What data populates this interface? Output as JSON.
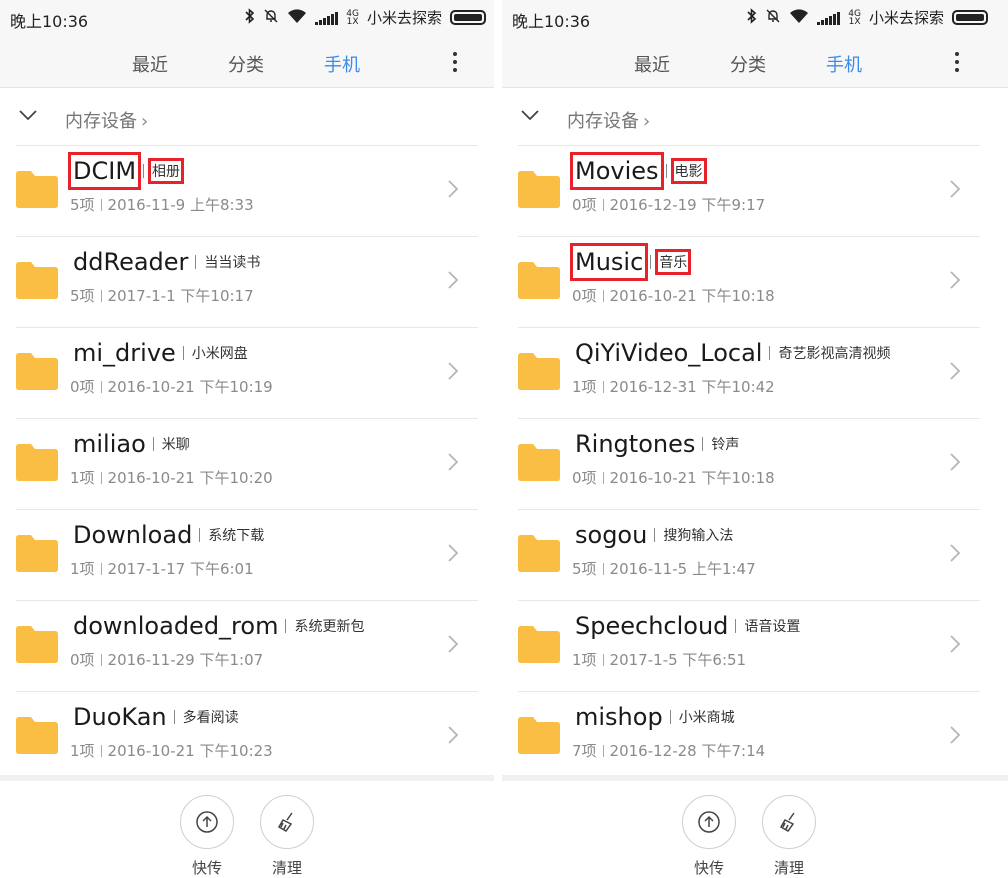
{
  "status": {
    "time": "晚上10:36",
    "network_top": "4G",
    "network_bottom": "1X",
    "carrier": "小米去探索"
  },
  "tabs": [
    {
      "label": "最近",
      "active": false
    },
    {
      "label": "分类",
      "active": false
    },
    {
      "label": "手机",
      "active": true
    }
  ],
  "breadcrumb": {
    "label": "内存设备",
    "arrow": "›"
  },
  "left_list": [
    {
      "name": "DCIM",
      "alias": "相册",
      "count": "5项",
      "date": "2016-11-9 上午8:33",
      "highlight": true
    },
    {
      "name": "ddReader",
      "alias": "当当读书",
      "count": "5项",
      "date": "2017-1-1 下午10:17",
      "highlight": false
    },
    {
      "name": "mi_drive",
      "alias": "小米网盘",
      "count": "0项",
      "date": "2016-10-21 下午10:19",
      "highlight": false
    },
    {
      "name": "miliao",
      "alias": "米聊",
      "count": "1项",
      "date": "2016-10-21 下午10:20",
      "highlight": false
    },
    {
      "name": "Download",
      "alias": "系统下载",
      "count": "1项",
      "date": "2017-1-17 下午6:01",
      "highlight": false
    },
    {
      "name": "downloaded_rom",
      "alias": "系统更新包",
      "count": "0项",
      "date": "2016-11-29 下午1:07",
      "highlight": false
    },
    {
      "name": "DuoKan",
      "alias": "多看阅读",
      "count": "1项",
      "date": "2016-10-21 下午10:23",
      "highlight": false
    }
  ],
  "right_list": [
    {
      "name": "Movies",
      "alias": "电影",
      "count": "0项",
      "date": "2016-12-19 下午9:17",
      "highlight": true
    },
    {
      "name": "Music",
      "alias": "音乐",
      "count": "0项",
      "date": "2016-10-21 下午10:18",
      "highlight": true
    },
    {
      "name": "QiYiVideo_Local",
      "alias": "奇艺影视高清视频",
      "count": "1项",
      "date": "2016-12-31 下午10:42",
      "highlight": false
    },
    {
      "name": "Ringtones",
      "alias": "铃声",
      "count": "0项",
      "date": "2016-10-21 下午10:18",
      "highlight": false
    },
    {
      "name": "sogou",
      "alias": "搜狗输入法",
      "count": "5项",
      "date": "2016-11-5 上午1:47",
      "highlight": false
    },
    {
      "name": "Speechcloud",
      "alias": "语音设置",
      "count": "1项",
      "date": "2017-1-5 下午6:51",
      "highlight": false
    },
    {
      "name": "mishop",
      "alias": "小米商城",
      "count": "7项",
      "date": "2016-12-28 下午7:14",
      "highlight": false
    }
  ],
  "bottom": {
    "transfer_label": "快传",
    "clean_label": "清理"
  },
  "colors": {
    "accent": "#3a8be8",
    "folder": "#fbbe45",
    "highlight": "#e8222a"
  },
  "icons": {
    "folder": "folder-icon",
    "chevron": "chevron-right-icon",
    "transfer": "upload-arrow-icon",
    "clean": "broom-icon"
  }
}
